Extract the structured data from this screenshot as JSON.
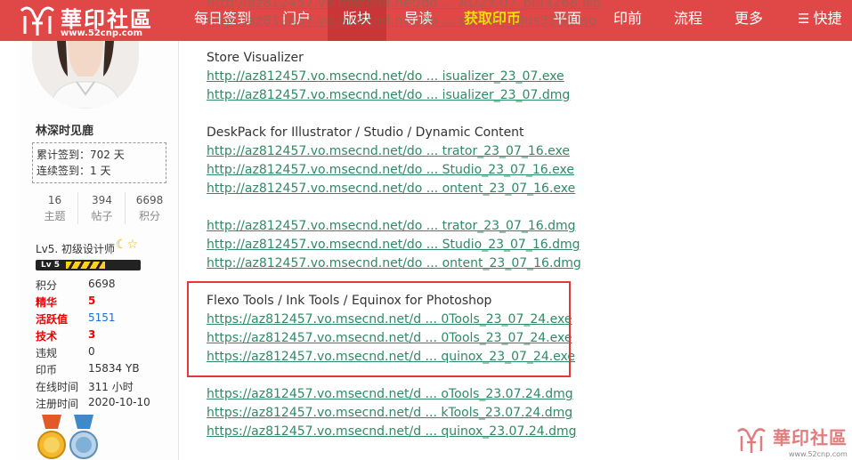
{
  "site": {
    "logo_text": "華印社區",
    "logo_url": "www.52cnp.com",
    "brand_color": "#e04848"
  },
  "nav": {
    "items": [
      {
        "label": "每日签到"
      },
      {
        "label": "门户"
      },
      {
        "label": "版块"
      },
      {
        "label": "导读"
      },
      {
        "label": "获取印币"
      },
      {
        "label": "平面"
      },
      {
        "label": "印前"
      },
      {
        "label": "流程"
      },
      {
        "label": "更多"
      },
      {
        "label": "快捷"
      }
    ],
    "ghost_links": [
      "http://az812457.vo.msecnd.net/do ... AD23.07_plu3268.iso",
      "http://az812457.vo.msecnd.net/do ... e23.07_plus3268.iso"
    ]
  },
  "user": {
    "name": "林深时见鹿",
    "sign_total_label": "累计签到：",
    "sign_total_value": "702 天",
    "sign_streak_label": "连续签到：",
    "sign_streak_value": "1 天",
    "stats": [
      {
        "value": "16",
        "label": "主题"
      },
      {
        "value": "394",
        "label": "帖子"
      },
      {
        "value": "6698",
        "label": "积分"
      }
    ],
    "level": "Lv5. 初级设计师",
    "level_badge": "Lv 5",
    "level_progress": 0.55,
    "info": [
      {
        "key": "积分",
        "value": "6698",
        "style": "normal"
      },
      {
        "key": "精华",
        "value": "5",
        "style": "red"
      },
      {
        "key": "活跃值",
        "value": "5151",
        "style": "blue"
      },
      {
        "key": "技术",
        "value": "3",
        "style": "red"
      },
      {
        "key": "违规",
        "value": "0",
        "style": "normal"
      },
      {
        "key": "印币",
        "value": "15834 YB",
        "style": "normal"
      },
      {
        "key": "在线时间",
        "value": "311 小时",
        "style": "normal"
      },
      {
        "key": "注册时间",
        "value": "2020-10-10",
        "style": "normal"
      }
    ]
  },
  "content": {
    "blocks": [
      {
        "title": "Store Visualizer",
        "links": [
          "http://az812457.vo.msecnd.net/do ... isualizer_23_07.exe",
          "http://az812457.vo.msecnd.net/do ... isualizer_23_07.dmg"
        ]
      },
      {
        "title": "DeskPack for Illustrator / Studio / Dynamic Content",
        "links": [
          "http://az812457.vo.msecnd.net/do ... trator_23_07_16.exe",
          "http://az812457.vo.msecnd.net/do ... Studio_23_07_16.exe",
          "http://az812457.vo.msecnd.net/do ... ontent_23_07_16.exe"
        ]
      },
      {
        "title": "",
        "links": [
          "http://az812457.vo.msecnd.net/do ... trator_23_07_16.dmg",
          "http://az812457.vo.msecnd.net/do ... Studio_23_07_16.dmg",
          "http://az812457.vo.msecnd.net/do ... ontent_23_07_16.dmg"
        ]
      },
      {
        "title": "Flexo Tools / Ink Tools / Equinox for Photoshop",
        "links": [
          "https://az812457.vo.msecnd.net/d ... 0Tools_23_07_24.exe",
          "https://az812457.vo.msecnd.net/d ... 0Tools_23_07_24.exe",
          "https://az812457.vo.msecnd.net/d ... quinox_23_07_24.exe"
        ]
      },
      {
        "title": "",
        "links": [
          "https://az812457.vo.msecnd.net/d ... oTools_23.07.24.dmg",
          "https://az812457.vo.msecnd.net/d ... kTools_23.07.24.dmg",
          "https://az812457.vo.msecnd.net/d ... quinox_23.07.24.dmg"
        ]
      }
    ],
    "highlight_color": "#e23a3a",
    "link_color": "#2f8a65"
  },
  "watermark": {
    "text": "華印社區",
    "url": "www.52cnp.com"
  }
}
